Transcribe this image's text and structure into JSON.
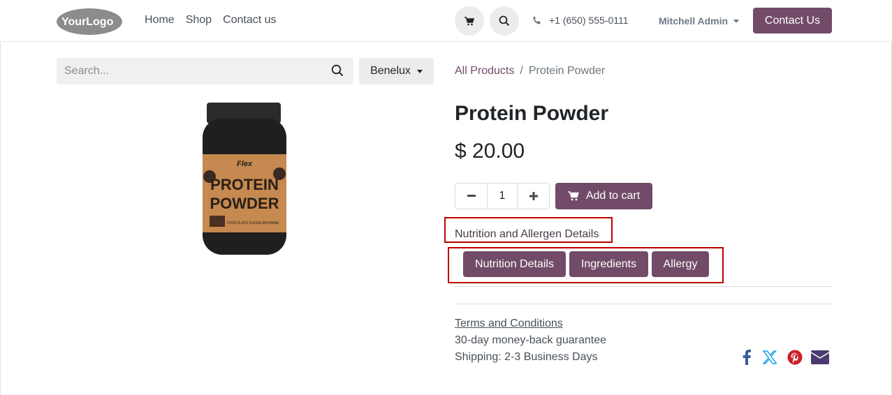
{
  "header": {
    "logo_text": "YourLogo",
    "nav": [
      "Home",
      "Shop",
      "Contact us"
    ],
    "cart_icon": "cart-icon",
    "search_icon": "search-icon",
    "phone": "+1 (650) 555-0111",
    "user": "Mitchell Admin",
    "contact_button": "Contact Us"
  },
  "search": {
    "placeholder": "Search...",
    "region": "Benelux"
  },
  "product": {
    "image_label_brand": "Flex",
    "image_label_line1": "PROTEIN",
    "image_label_line2": "POWDER",
    "image_label_flavor": "CHOCOLATE FUDGE BROWNIE",
    "breadcrumb_parent": "All Products",
    "breadcrumb_separator": "/",
    "breadcrumb_current": "Protein Powder",
    "name": "Protein Powder",
    "price": "$ 20.00",
    "quantity": "1",
    "add_to_cart": "Add to cart",
    "allergen_title": "Nutrition and Allergen Details",
    "tabs": [
      "Nutrition Details",
      "Ingredients",
      "Allergy"
    ],
    "terms": "Terms and Conditions",
    "guarantee": "30-day money-back guarantee",
    "shipping": "Shipping: 2-3 Business Days"
  },
  "colors": {
    "brand": "#714b67",
    "highlight": "#c00000",
    "facebook": "#3b5998",
    "twitter": "#1da1f2",
    "pinterest": "#cb2027",
    "email": "#4b3a6e"
  },
  "social": [
    "facebook-icon",
    "x-twitter-icon",
    "pinterest-icon",
    "email-icon"
  ]
}
